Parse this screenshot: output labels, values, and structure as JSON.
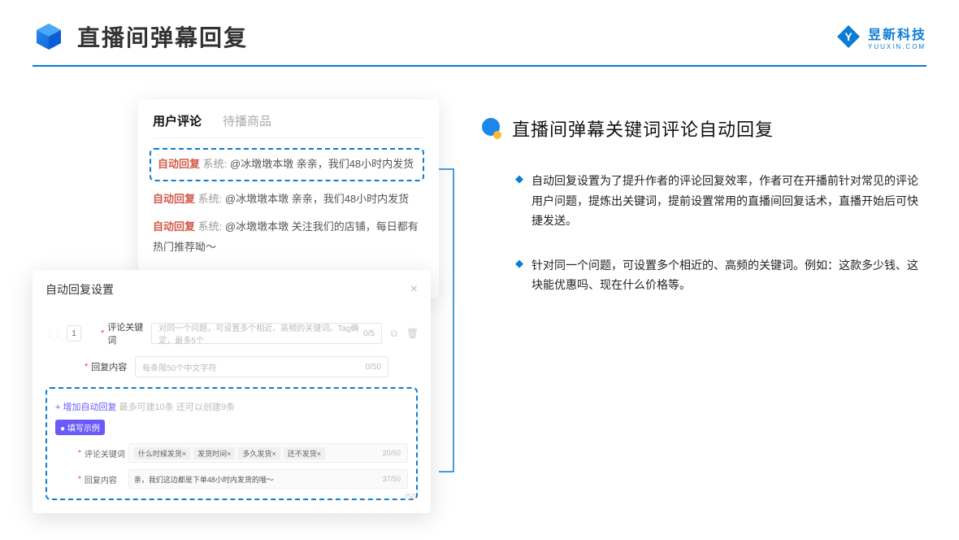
{
  "header": {
    "title": "直播间弹幕回复",
    "logo_main": "昱新科技",
    "logo_sub": "YUUXIN.COM"
  },
  "chat": {
    "tabs": [
      "用户评论",
      "待播商品"
    ],
    "active_tab_index": 0,
    "comments": [
      {
        "tag": "自动回复",
        "sys": "系统:",
        "text": "@冰墩墩本墩 亲亲，我们48小时内发货",
        "highlighted": true
      },
      {
        "tag": "自动回复",
        "sys": "系统:",
        "text": "@冰墩墩本墩 亲亲，我们48小时内发货",
        "highlighted": false
      },
      {
        "tag": "自动回复",
        "sys": "系统:",
        "text": "@冰墩墩本墩 关注我们的店铺，每日都有热门推荐呦～",
        "highlighted": false
      }
    ]
  },
  "settings": {
    "title": "自动回复设置",
    "index": "1",
    "keyword_label": "评论关键词",
    "keyword_placeholder": "对同一个问题，可设置多个相近、高频的关键词。Tag确定，最多5个",
    "keyword_count": "0/5",
    "content_label": "回复内容",
    "content_placeholder": "每条限50个中文字符",
    "content_count": "0/50",
    "add_link": "+ 增加自动回复",
    "add_hint": "最多可建10条 还可以创建9条",
    "example_badge": "● 填写示例",
    "ex_keyword_label": "评论关键词",
    "ex_keyword_tags": [
      "什么时候发货×",
      "发货时间×",
      "多久发货×",
      "还不发货×"
    ],
    "ex_keyword_count": "20/50",
    "ex_content_label": "回复内容",
    "ex_content_text": "亲，我们这边都是下单48小时内发货的哦～",
    "ex_content_count": "37/50",
    "orphan_count": "/50"
  },
  "right": {
    "section_title": "直播间弹幕关键词评论自动回复",
    "bullets": [
      "自动回复设置为了提升作者的评论回复效率，作者可在开播前针对常见的评论用户问题，提炼出关键词，提前设置常用的直播间回复话术，直播开始后可快捷发送。",
      "针对同一个问题，可设置多个相近的、高频的关键词。例如：这款多少钱、这块能优惠吗、现在什么价格等。"
    ]
  }
}
